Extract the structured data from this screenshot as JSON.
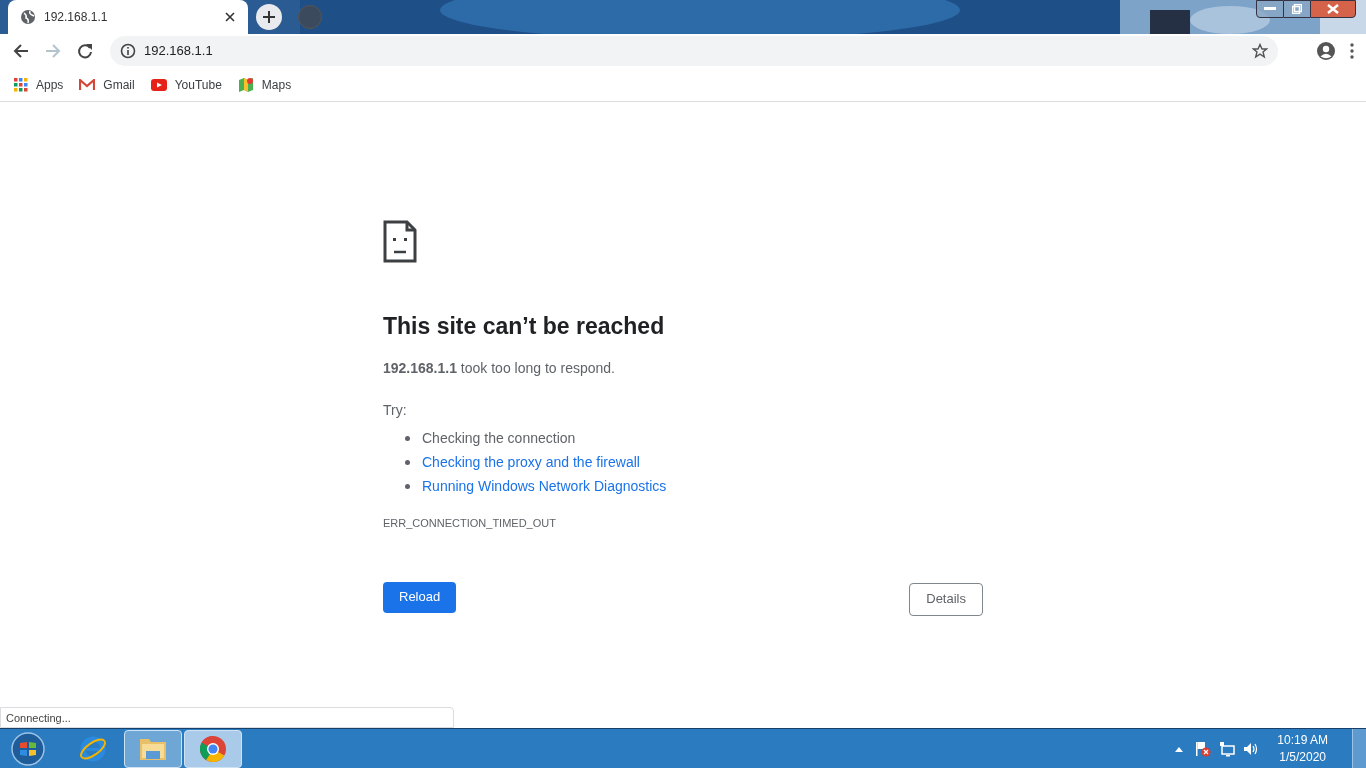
{
  "tab": {
    "title": "192.168.1.1",
    "selected": true
  },
  "address_bar": {
    "url": "192.168.1.1"
  },
  "bookmarks": [
    {
      "label": "Apps",
      "kind": "apps"
    },
    {
      "label": "Gmail",
      "kind": "gmail"
    },
    {
      "label": "YouTube",
      "kind": "youtube"
    },
    {
      "label": "Maps",
      "kind": "maps"
    }
  ],
  "error": {
    "heading": "This site can’t be reached",
    "message": "**192.168.1.1** took too long to respond.",
    "try_label": "Try:",
    "suggestions": [
      {
        "text": "Checking the connection",
        "link": false
      },
      {
        "text": "Checking the proxy and the firewall",
        "link": true
      },
      {
        "text": "Running Windows Network Diagnostics",
        "link": true
      }
    ],
    "code": "ERR_CONNECTION_TIMED_OUT",
    "primary_button": "Reload",
    "secondary_button": "Details"
  },
  "status_bubble": "Connecting...",
  "taskbar": {
    "apps": [
      {
        "kind": "ie",
        "running": false,
        "selected": false
      },
      {
        "kind": "explorer",
        "running": true,
        "selected": false
      },
      {
        "kind": "chrome",
        "running": true,
        "selected": true
      }
    ],
    "clock": {
      "time": "10:19 AM",
      "date": "1/5/2020"
    }
  }
}
